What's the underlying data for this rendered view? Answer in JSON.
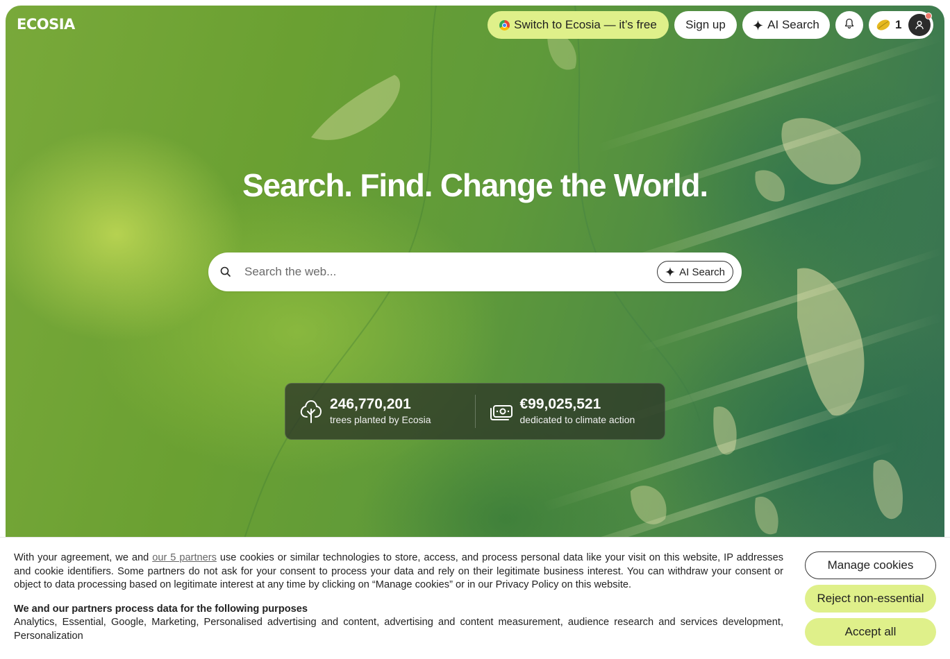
{
  "brand": {
    "logo_text": "ECOSIA"
  },
  "header": {
    "switch_label": "Switch to Ecosia — it’s free",
    "signup_label": "Sign up",
    "ai_search_label": "AI Search",
    "seed_count": "1"
  },
  "hero": {
    "headline": "Search. Find. Change the World."
  },
  "search": {
    "placeholder": "Search the web...",
    "value": "",
    "ai_button_label": "AI Search"
  },
  "stats": [
    {
      "number": "246,770,201",
      "label": "trees planted by Ecosia",
      "icon": "tree-icon"
    },
    {
      "number": "€99,025,521",
      "label": "dedicated to climate action",
      "icon": "money-icon"
    }
  ],
  "cookie_banner": {
    "intro_before_link": "With your agreement, we and ",
    "partners_link": "our 5 partners",
    "intro_after_link": " use cookies or similar technologies to store, access, and process personal data like your visit on this website, IP addresses and cookie identifiers. Some partners do not ask for your consent to process your data and rely on their legitimate business interest. You can withdraw your consent or object to data processing based on legitimate interest at any time by clicking on “Manage cookies” or in our Privacy Policy on this website.",
    "purposes_title": "We and our partners process data for the following purposes",
    "purposes_list": "Analytics, Essential, Google, Marketing, Personalised advertising and content, advertising and content measurement, audience research and services development, Personalization",
    "manage_label": "Manage cookies",
    "reject_label": "Reject non-essential",
    "accept_label": "Accept all"
  },
  "colors": {
    "accent_lime": "#dff08a",
    "notification_dot": "#f07a6c",
    "stats_panel": "#2d3728"
  }
}
